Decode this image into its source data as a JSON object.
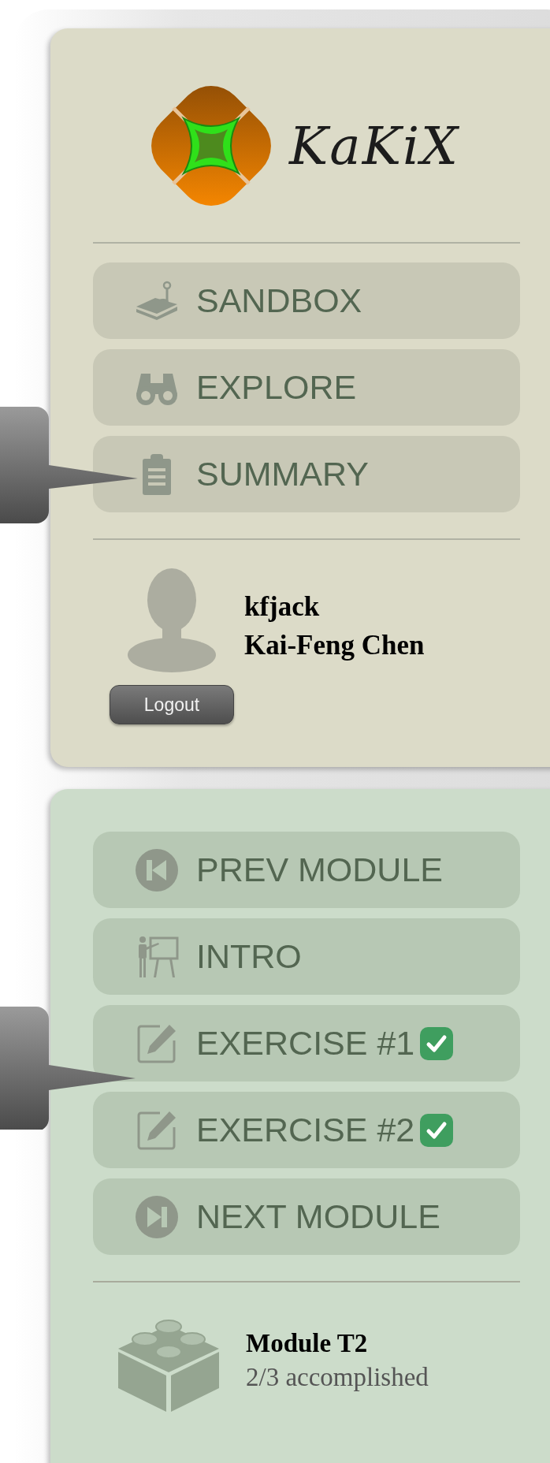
{
  "logo": {
    "text": "KaKiX"
  },
  "main_menu": [
    {
      "kind": "sandbox",
      "label": "SANDBOX"
    },
    {
      "kind": "explore",
      "label": "EXPLORE"
    },
    {
      "kind": "summary",
      "label": "SUMMARY"
    }
  ],
  "user": {
    "username": "kfjack",
    "full_name": "Kai-Feng Chen",
    "logout_label": "Logout"
  },
  "module_menu": [
    {
      "kind": "prev",
      "label": "PREV MODULE",
      "completed": false
    },
    {
      "kind": "intro",
      "label": "INTRO",
      "completed": false
    },
    {
      "kind": "exercise",
      "label": "EXERCISE #1",
      "completed": true
    },
    {
      "kind": "exercise",
      "label": "EXERCISE #2",
      "completed": true
    },
    {
      "kind": "next",
      "label": "NEXT MODULE",
      "completed": false
    }
  ],
  "module": {
    "title": "Module T2",
    "progress": "2/3 accomplished"
  }
}
